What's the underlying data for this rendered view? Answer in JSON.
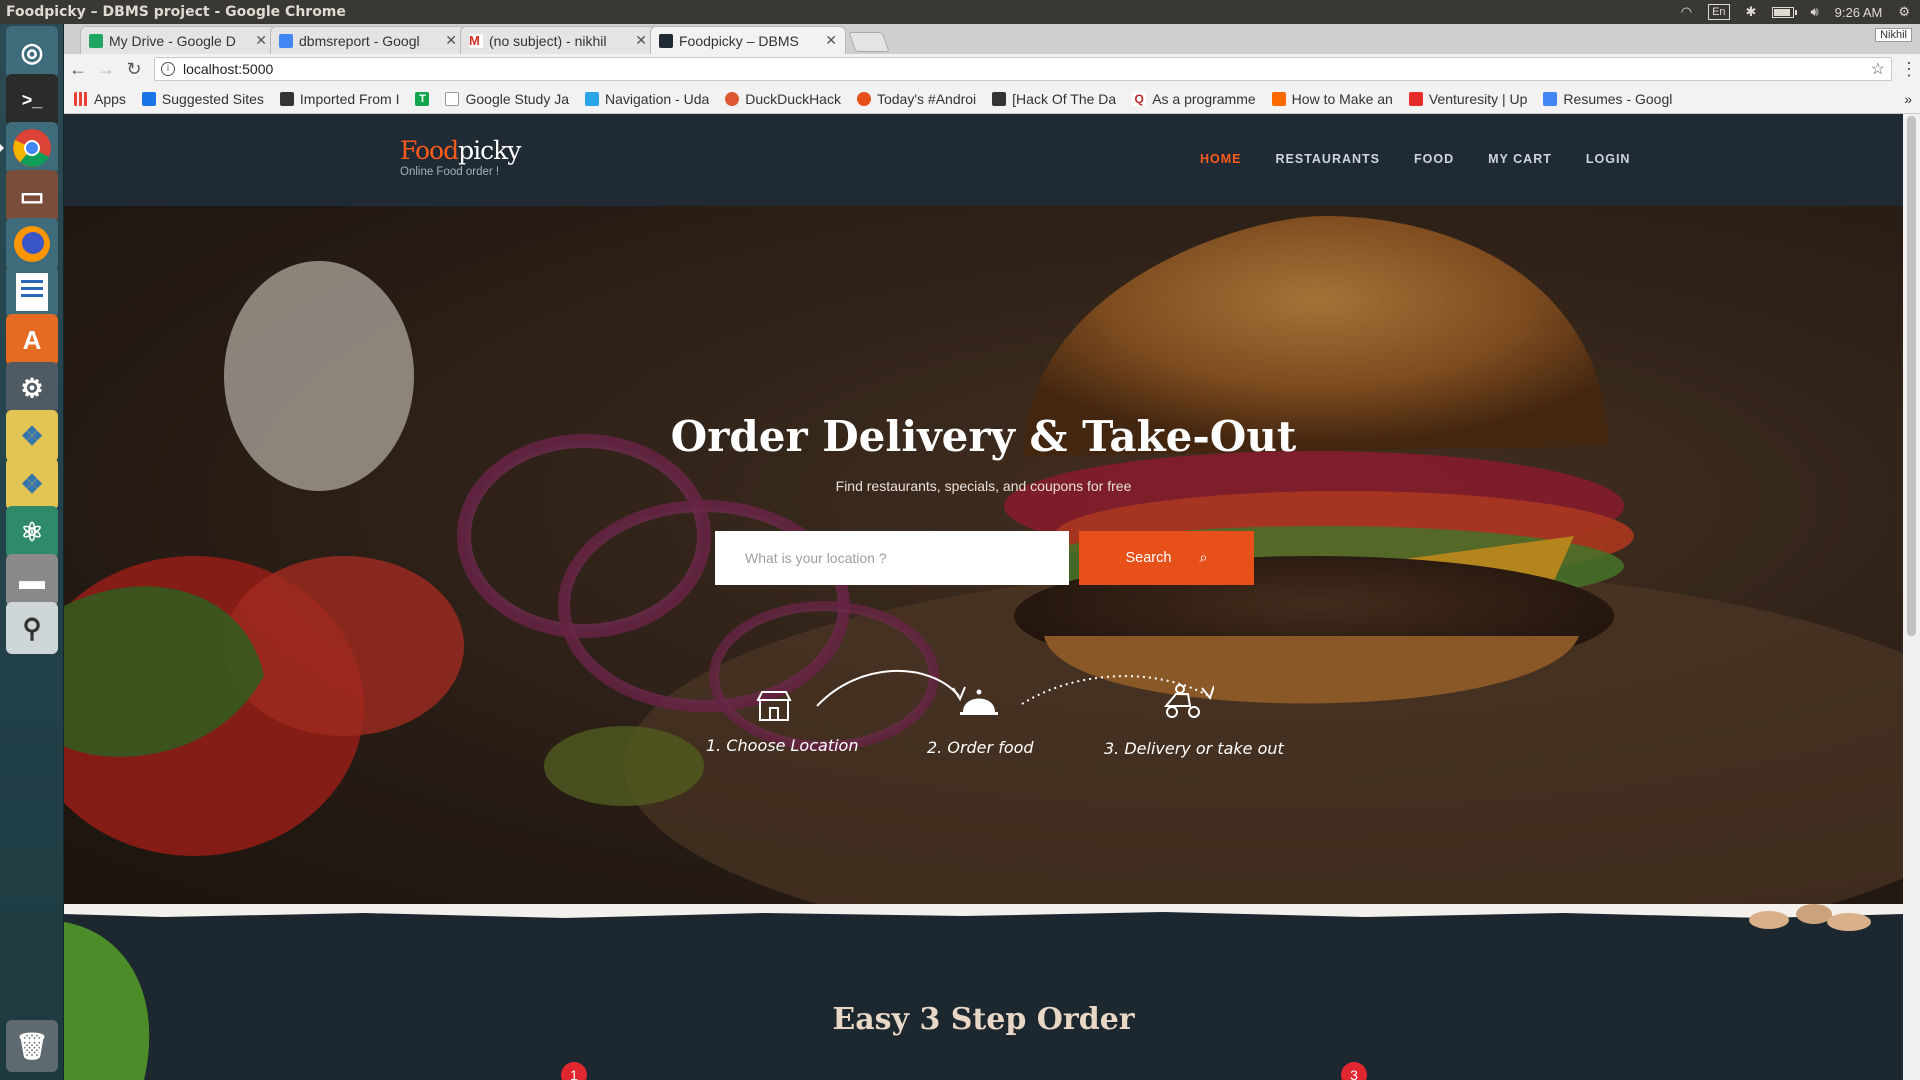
{
  "os": {
    "window_title": "Foodpicky – DBMS project - Google Chrome",
    "lang": "En",
    "time": "9:26 AM"
  },
  "browser": {
    "tabs": [
      {
        "label": "My Drive - Google D",
        "fav_color": "#1fa463"
      },
      {
        "label": "dbmsreport - Googl",
        "fav_color": "#4285f4"
      },
      {
        "label": "(no subject) - nikhil",
        "fav_color": "#d93025"
      },
      {
        "label": "Foodpicky – DBMS",
        "fav_color": "#1f2a35"
      }
    ],
    "profile": "Nikhil",
    "url": "localhost:5000",
    "bookmarks": [
      {
        "label": "Apps",
        "color": "#ea4335"
      },
      {
        "label": "Suggested Sites",
        "color": "#1a73e8"
      },
      {
        "label": "Imported From I",
        "color": "#333333"
      },
      {
        "label": "",
        "color": "#11a64b"
      },
      {
        "label": "Google Study Ja",
        "color": "#999999"
      },
      {
        "label": "Navigation - Uda",
        "color": "#2aa6e8"
      },
      {
        "label": "DuckDuckHack",
        "color": "#de5833"
      },
      {
        "label": "Today's #Androi",
        "color": "#e8501a"
      },
      {
        "label": "[Hack Of The Da",
        "color": "#333333"
      },
      {
        "label": "As a programme",
        "color": "#b92b27"
      },
      {
        "label": "How to Make an",
        "color": "#ff6a00"
      },
      {
        "label": "Venturesity | Up",
        "color": "#e62b2b"
      },
      {
        "label": "Resumes - Googl",
        "color": "#4285f4"
      }
    ]
  },
  "site": {
    "logo_a": "Food",
    "logo_b": "picky",
    "tagline": "Online Food order !",
    "nav": [
      "HOME",
      "RESTAURANTS",
      "FOOD",
      "MY CART",
      "LOGIN"
    ],
    "hero": {
      "title": "Order Delivery & Take-Out",
      "subtitle": "Find restaurants, specials, and coupons for free",
      "placeholder": "What is your location ?",
      "search_label": "Search",
      "steps": [
        "1. Choose Location",
        "2. Order food",
        "3. Delivery or take out"
      ]
    },
    "how": {
      "title": "Easy 3 Step Order",
      "badges": [
        "1",
        "3"
      ]
    }
  }
}
